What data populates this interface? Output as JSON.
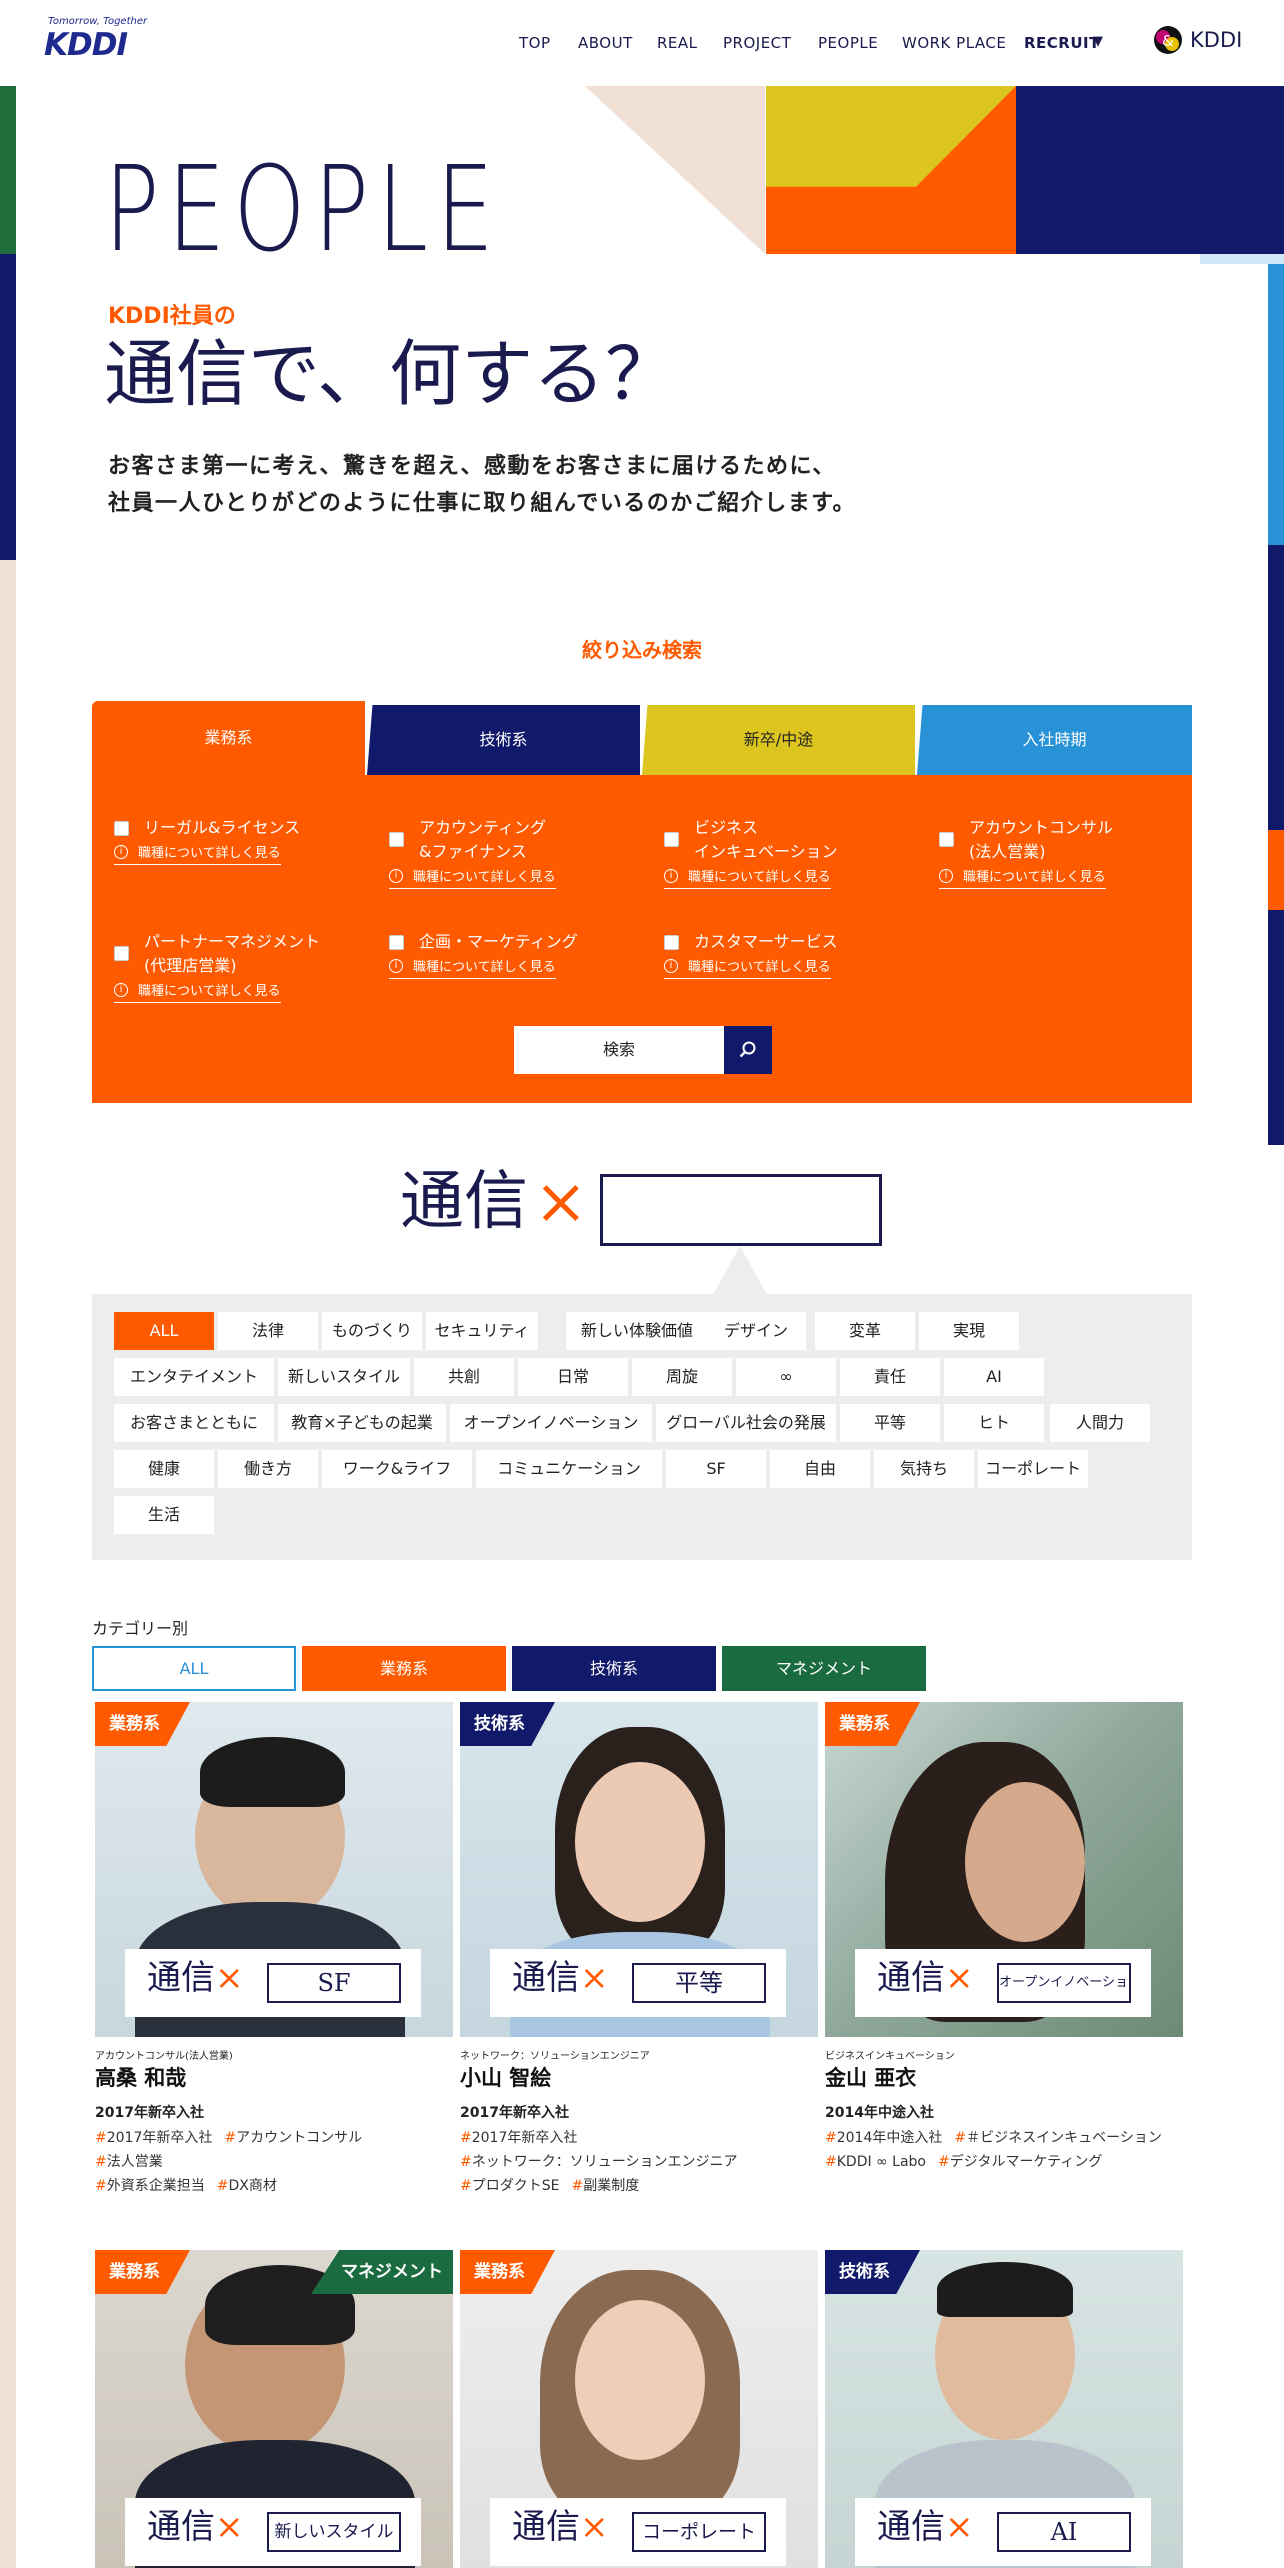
{
  "header": {
    "logo_tagline": "Tomorrow, Together",
    "logo": "KDDI",
    "nav": [
      "TOP",
      "ABOUT",
      "REAL",
      "PROJECT",
      "PEOPLE",
      "WORK PLACE",
      "RECRUIT"
    ],
    "brand": "KDDI"
  },
  "hero": {
    "title": "PEOPLE",
    "sub": "KDDI社員の",
    "headline": "通信で、何する？",
    "desc_line1": "お客さま第一に考え、驚きを超え、感動をお客さまに届けるために、",
    "desc_line2": "社員一人ひとりがどのように仕事に取り組んでいるのかご紹介します。"
  },
  "filter": {
    "title": "絞り込み検索",
    "tabs": [
      "業務系",
      "技術系",
      "新卒/中途",
      "入社時期"
    ],
    "more_label": "職種について詳しく見る",
    "items": [
      {
        "line1": "リーガル&ライセンス",
        "line2": ""
      },
      {
        "line1": "アカウンティング",
        "line2": "&ファイナンス"
      },
      {
        "line1": "ビジネス",
        "line2": "インキュベーション"
      },
      {
        "line1": "アカウントコンサル",
        "line2": "(法人営業)"
      },
      {
        "line1": "パートナーマネジメント",
        "line2": "(代理店営業)"
      },
      {
        "line1": "企画・マーケティング",
        "line2": ""
      },
      {
        "line1": "カスタマーサービス",
        "line2": ""
      }
    ],
    "search_label": "検索"
  },
  "tsushin": {
    "word": "通信",
    "x": "×"
  },
  "tags": [
    "ALL",
    "法律",
    "ものづくり",
    "セキュリティ",
    "新しい体験価値",
    "デザイン",
    "変革",
    "実現",
    "エンタテイメント",
    "新しいスタイル",
    "共創",
    "日常",
    "周旋",
    "∞",
    "責任",
    "AI",
    "お客さまとともに",
    "教育×子どもの起業",
    "オープンイノベーション",
    "グローバル社会の発展",
    "平等",
    "ヒト",
    "人間力",
    "健康",
    "働き方",
    "ワーク&ライフ",
    "コミュニケーション",
    "SF",
    "自由",
    "気持ち",
    "コーポレート",
    "生活"
  ],
  "categories": {
    "label": "カテゴリー別",
    "items": [
      "ALL",
      "業務系",
      "技術系",
      "マネジメント"
    ]
  },
  "people": [
    {
      "badge": "業務系",
      "badge2": "",
      "phrase": "SF",
      "role": "アカウントコンサル(法人営業)",
      "name": "高桑 和哉",
      "year": "2017年新卒入社",
      "tags": [
        "2017年新卒入社",
        "アカウントコンサル",
        "法人営業",
        "外資系企業担当",
        "DX商材"
      ]
    },
    {
      "badge": "技術系",
      "badge2": "",
      "phrase": "平等",
      "role": "ネットワーク：ソリューションエンジニア",
      "name": "小山 智絵",
      "year": "2017年新卒入社",
      "tags": [
        "2017年新卒入社",
        "ネットワーク：ソリューションエンジニア",
        "プロダクトSE",
        "副業制度"
      ]
    },
    {
      "badge": "業務系",
      "badge2": "",
      "phrase": "オープンイノベーション",
      "role": "ビジネスインキュベーション",
      "name": "金山 亜衣",
      "year": "2014年中途入社",
      "tags": [
        "2014年中途入社",
        "＃ビジネスインキュベーション",
        "KDDI ∞ Labo",
        "デジタルマーケティング"
      ]
    },
    {
      "badge": "業務系",
      "badge2": "マネジメント",
      "phrase": "新しいスタイル",
      "role": "",
      "name": "",
      "year": "",
      "tags": []
    },
    {
      "badge": "業務系",
      "badge2": "",
      "phrase": "コーポレート",
      "role": "",
      "name": "",
      "year": "",
      "tags": []
    },
    {
      "badge": "技術系",
      "badge2": "",
      "phrase": "AI",
      "role": "",
      "name": "",
      "year": "",
      "tags": []
    }
  ],
  "colors": {
    "orange": "#ff5a00",
    "navy": "#111a6a",
    "yellow": "#dcc51f",
    "blue": "#2792d6",
    "green": "#1a6b3f",
    "beige": "#f0e0d6"
  }
}
